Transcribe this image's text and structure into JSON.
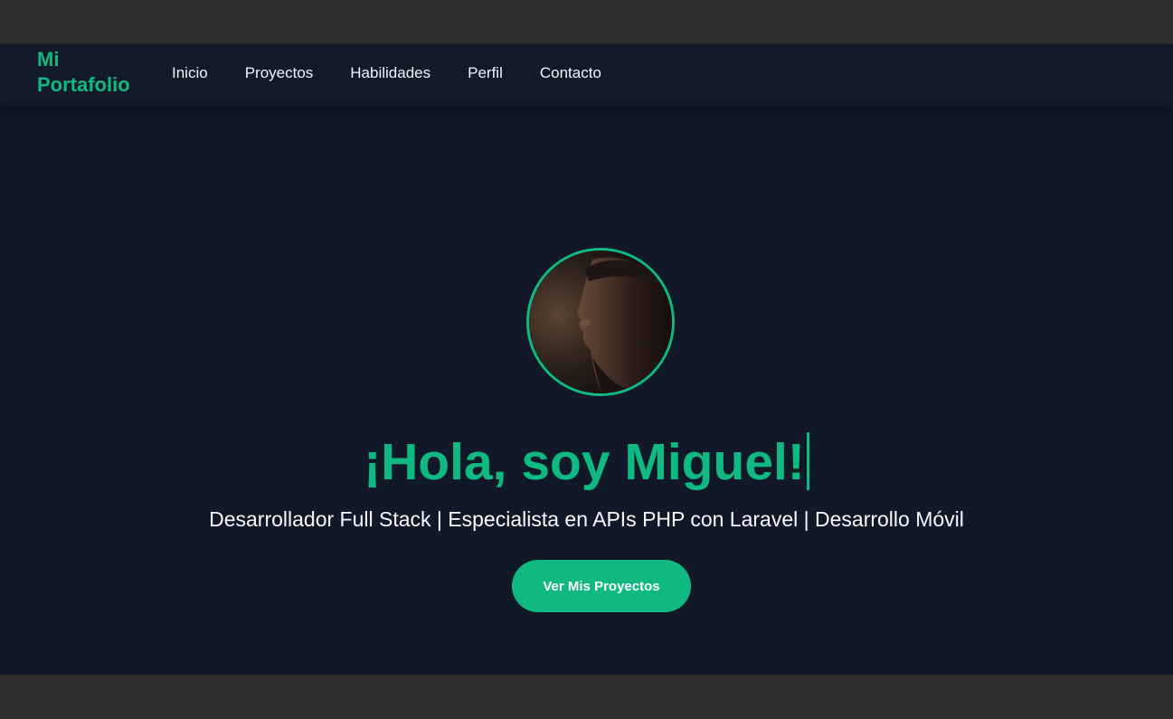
{
  "brand": {
    "line1": "Mi",
    "line2": "Portafolio"
  },
  "nav": {
    "items": [
      {
        "label": "Inicio"
      },
      {
        "label": "Proyectos"
      },
      {
        "label": "Habilidades"
      },
      {
        "label": "Perfil"
      },
      {
        "label": "Contacto"
      }
    ]
  },
  "hero": {
    "avatar_icon": "profile-photo",
    "title": "¡Hola, soy Miguel!",
    "subtitle": "Desarrollador Full Stack | Especialista en APIs PHP con Laravel | Desarrollo Móvil",
    "cta_label": "Ver Mis Proyectos"
  },
  "colors": {
    "accent": "#10b981",
    "background": "#111827",
    "navbar": "#121a29",
    "text": "#f8fafc"
  }
}
